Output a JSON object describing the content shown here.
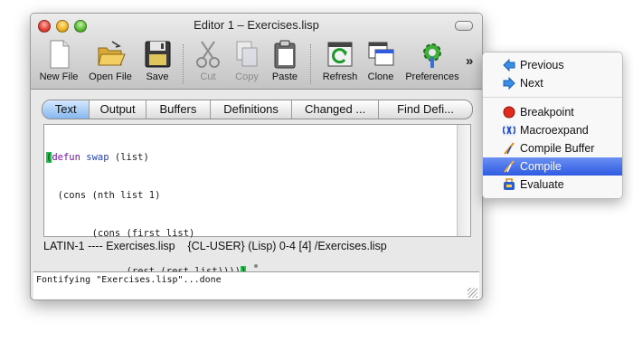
{
  "window": {
    "title": "Editor 1 – Exercises.lisp"
  },
  "toolbar": {
    "items": [
      {
        "label": "New File",
        "icon": "new-file-icon",
        "enabled": true
      },
      {
        "label": "Open File",
        "icon": "open-folder-icon",
        "enabled": true
      },
      {
        "label": "Save",
        "icon": "floppy-disk-icon",
        "enabled": true
      },
      {
        "label": "Cut",
        "icon": "scissors-icon",
        "enabled": false
      },
      {
        "label": "Copy",
        "icon": "copy-icon",
        "enabled": false
      },
      {
        "label": "Paste",
        "icon": "paste-clipboard-icon",
        "enabled": true
      },
      {
        "label": "Refresh",
        "icon": "refresh-icon",
        "enabled": true
      },
      {
        "label": "Clone",
        "icon": "clone-window-icon",
        "enabled": true
      },
      {
        "label": "Preferences",
        "icon": "preferences-gear-icon",
        "enabled": true
      }
    ],
    "overflow": "»"
  },
  "tabs": {
    "active": "Text",
    "items": [
      "Text",
      "Output",
      "Buffers",
      "Definitions",
      "Changed ...",
      "Find Defi..."
    ]
  },
  "editor": {
    "lines": [
      "(defun swap (list)",
      "  (cons (nth list 1)",
      "        (cons (first list)",
      "              (rest (rest list)))))"
    ]
  },
  "status": {
    "text": "LATIN-1 ---- Exercises.lisp    {CL-USER} (Lisp) 0-4 [4] /Exercises.lisp"
  },
  "echo": {
    "text": "Fontifying \"Exercises.lisp\"...done"
  },
  "overflow_menu": {
    "items": [
      {
        "label": "Previous",
        "icon": "left-arrow-icon"
      },
      {
        "label": "Next",
        "icon": "right-arrow-icon"
      },
      {
        "label": "Breakpoint",
        "icon": "breakpoint-red-dot-icon"
      },
      {
        "label": "Macroexpand",
        "icon": "macroexpand-icon"
      },
      {
        "label": "Compile Buffer",
        "icon": "compile-buffer-icon"
      },
      {
        "label": "Compile",
        "icon": "compile-icon",
        "selected": true
      },
      {
        "label": "Evaluate",
        "icon": "evaluate-icon"
      }
    ]
  },
  "colors": {
    "selection": "#2f5be2",
    "active_tab": "#86b7f0",
    "keyword": "#7a0fa6",
    "function_name": "#1d3fbf",
    "paren_match": "#22c34c"
  }
}
